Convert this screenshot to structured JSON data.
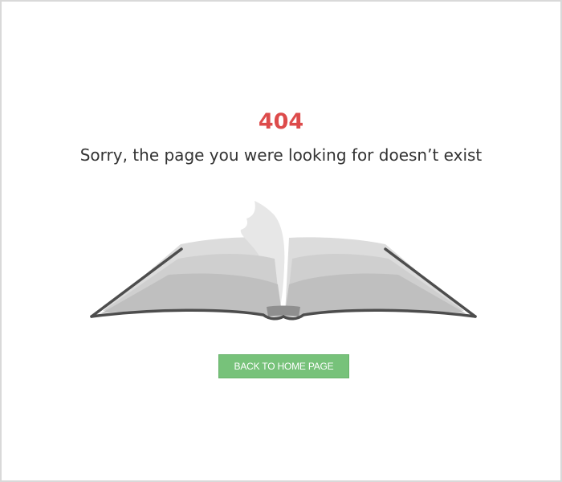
{
  "error": {
    "code": "404",
    "message": "Sorry, the page you were looking for doesn’t exist"
  },
  "illustration": {
    "icon": "open-book-icon"
  },
  "actions": {
    "home_label": "BACK TO HOME PAGE"
  },
  "colors": {
    "accent_red": "#dd4b4b",
    "button_green": "#77c27a",
    "border_gray": "#d9d9d9"
  }
}
